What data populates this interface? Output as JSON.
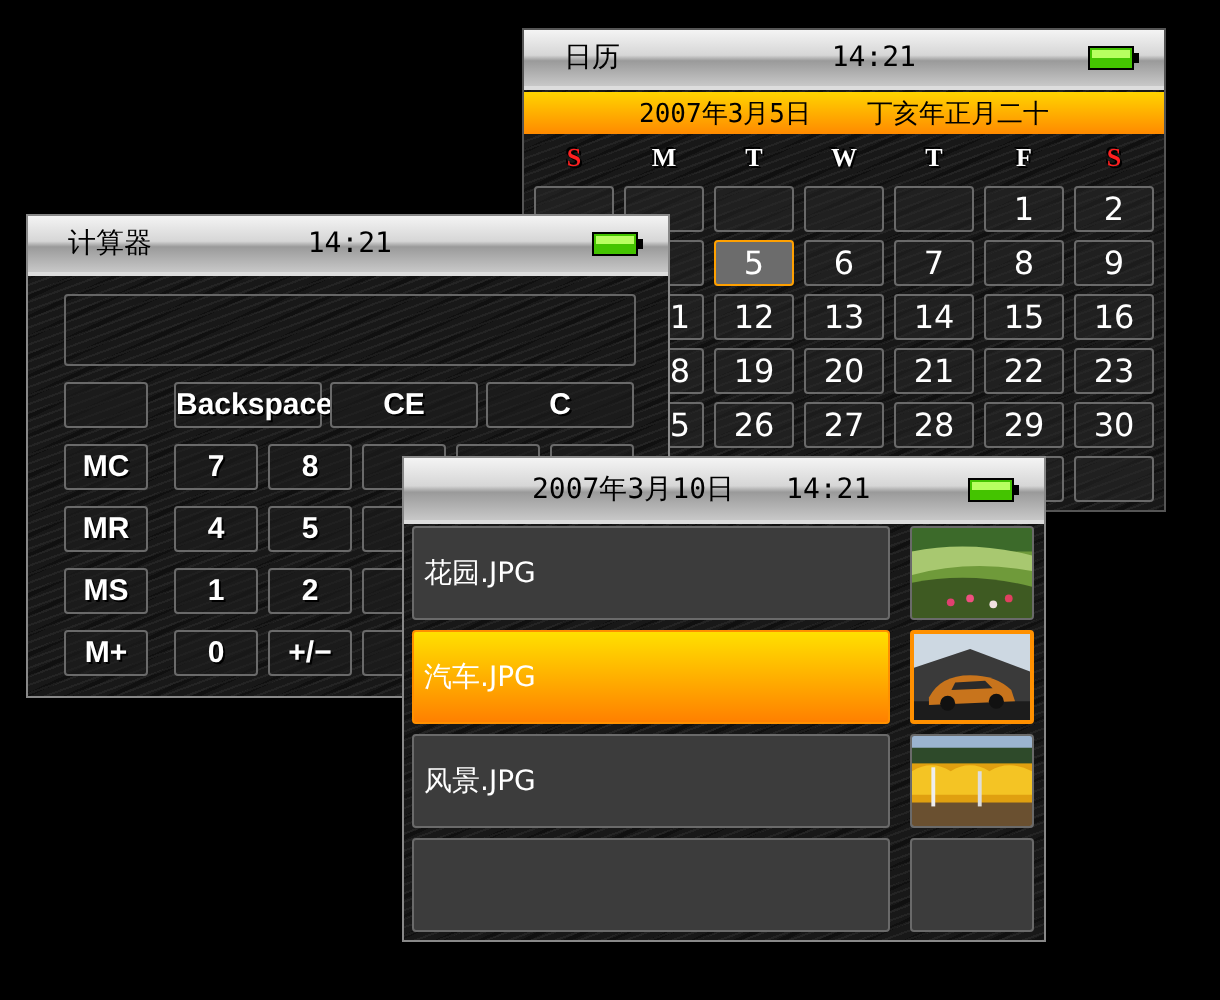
{
  "calendar": {
    "title": "日历",
    "time": "14:21",
    "date": "2007年3月5日",
    "lunar_date": "丁亥年正月二十",
    "weekdays": [
      {
        "label": "S",
        "color": "#ff2020"
      },
      {
        "label": "M",
        "color": "#ffffff"
      },
      {
        "label": "T",
        "color": "#ffffff"
      },
      {
        "label": "W",
        "color": "#ffffff"
      },
      {
        "label": "T",
        "color": "#ffffff"
      },
      {
        "label": "F",
        "color": "#ffffff"
      },
      {
        "label": "S",
        "color": "#ff2020"
      }
    ],
    "weeks": [
      [
        {
          "selected": false
        },
        {
          "selected": false
        },
        {
          "selected": false
        },
        {
          "selected": false
        },
        {
          "selected": false
        },
        {
          "day": "1",
          "selected": false
        },
        {
          "day": "2",
          "selected": false
        }
      ],
      [
        {
          "selected": false
        },
        {
          "day": "5",
          "selected": true
        },
        {
          "day": "6",
          "selected": false
        },
        {
          "day": "7",
          "selected": false
        },
        {
          "day": "8",
          "selected": false
        },
        {
          "day": "9",
          "selected": false
        }
      ],
      [
        {
          "day": "1",
          "selected": false
        },
        {
          "day": "12",
          "selected": false
        },
        {
          "day": "13",
          "selected": false
        },
        {
          "day": "14",
          "selected": false
        },
        {
          "day": "15",
          "selected": false
        },
        {
          "day": "16",
          "selected": false
        }
      ],
      [
        {
          "day": "8",
          "selected": false
        },
        {
          "day": "19",
          "selected": false
        },
        {
          "day": "20",
          "selected": false
        },
        {
          "day": "21",
          "selected": false
        },
        {
          "day": "22",
          "selected": false
        },
        {
          "day": "23",
          "selected": false
        }
      ],
      [
        {
          "day": "5",
          "selected": false
        },
        {
          "day": "26",
          "selected": false
        },
        {
          "day": "27",
          "selected": false
        },
        {
          "day": "28",
          "selected": false
        },
        {
          "day": "29",
          "selected": false
        },
        {
          "day": "30",
          "selected": false
        }
      ],
      [
        {
          "selected": false
        },
        {
          "selected": false
        }
      ]
    ]
  },
  "calculator": {
    "title": "计算器",
    "time": "14:21",
    "top_keys": [
      {
        "label": "Backspace"
      },
      {
        "label": "CE"
      },
      {
        "label": "C"
      }
    ],
    "key_rows": [
      {
        "memory_key": "MC",
        "keys": [
          {
            "label": "7"
          },
          {
            "label": "8"
          }
        ]
      },
      {
        "memory_key": "MR",
        "keys": [
          {
            "label": "4"
          },
          {
            "label": "5"
          }
        ]
      },
      {
        "memory_key": "MS",
        "keys": [
          {
            "label": "1"
          },
          {
            "label": "2"
          }
        ]
      },
      {
        "memory_key": "M+",
        "keys": [
          {
            "label": "0"
          },
          {
            "label": "+/−"
          }
        ]
      }
    ]
  },
  "photos": {
    "title": "2007年3月10日",
    "time": "14:21",
    "items": [
      {
        "name": "花园.JPG",
        "selected": false
      },
      {
        "name": "汽车.JPG",
        "selected": true
      },
      {
        "name": "风景.JPG",
        "selected": false
      },
      {
        "selected": false
      }
    ]
  }
}
